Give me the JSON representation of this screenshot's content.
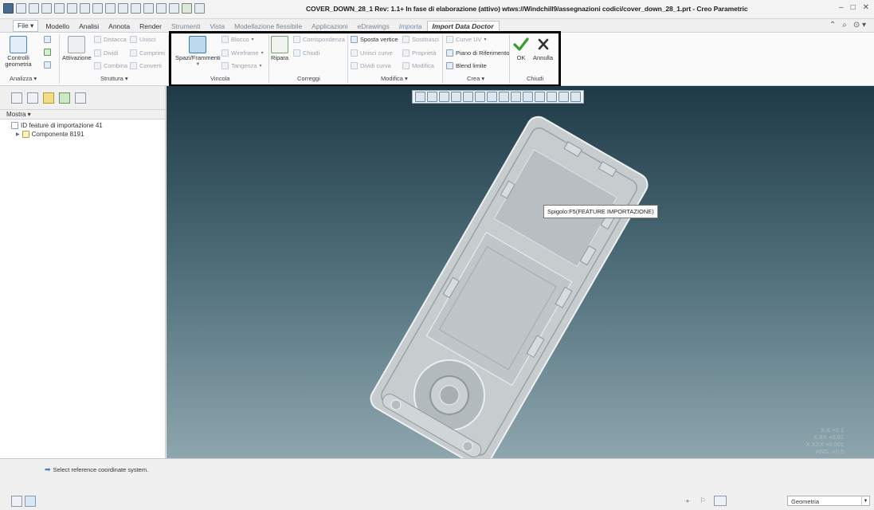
{
  "window": {
    "title": "COVER_DOWN_28_1 Rev: 1.1+ In fase di elaborazione  (attivo) wtws://Windchill9/assegnazioni codici/cover_down_28_1.prt - Creo Parametric",
    "controls": [
      "–",
      "□",
      "✕"
    ]
  },
  "tabs": [
    {
      "label": "File ▾"
    },
    {
      "label": "Modello"
    },
    {
      "label": "Analisi"
    },
    {
      "label": "Annota"
    },
    {
      "label": "Render"
    },
    {
      "label": "Strumenti"
    },
    {
      "label": "Vista"
    },
    {
      "label": "Modellazione flessibile"
    },
    {
      "label": "Applicazioni"
    },
    {
      "label": "eDrawings"
    },
    {
      "label": "Importa"
    },
    {
      "label": "Import Data Doctor"
    }
  ],
  "right_tools": [
    "⌃",
    "⌕",
    "⊙ ▾"
  ],
  "ribbon": {
    "analizza": {
      "group_label": "Analizza ▾",
      "controlli": "Controlli geometria"
    },
    "struttura": {
      "group_label": "Struttura ▾",
      "attivazione": "Attivazione",
      "distacca": "Distacca",
      "unisci": "Unisci",
      "dividi": "Dividi",
      "comprimi": "Comprimi",
      "combina": "Combina",
      "converti": "Converti"
    },
    "vincola": {
      "group_label": "Vincola",
      "spazi": "Spazi/Frammenti",
      "blocco": "Blocco",
      "wireframe": "Wireframe",
      "tangenza": "Tangenza"
    },
    "correggi": {
      "group_label": "Correggi",
      "ripara": "Ripara",
      "corrispondenza": "Corrispondenza",
      "chiudi": "Chiudi"
    },
    "modifica": {
      "group_label": "Modifica ▾",
      "sposta_vertice": "Sposta vertice",
      "sostituisci": "Sostituisci",
      "unisci_curve": "Unisci curve",
      "proprieta": "Proprietà",
      "dividi_curva": "Dividi curva",
      "modifica": "Modifica"
    },
    "crea": {
      "group_label": "Crea ▾",
      "curve_uv": "Curve UV",
      "piano": "Piano di Riferimento",
      "blend": "Blend limite"
    },
    "chiudi": {
      "group_label": "Chiudi",
      "ok": "OK",
      "annulla": "Annulla"
    }
  },
  "model_tree": {
    "mostra": "Mostra ▾",
    "items": [
      {
        "label": "ID feature di importazione 41"
      },
      {
        "label": "Componente 8191"
      }
    ]
  },
  "viewport": {
    "tooltip": "Spigolo:F5(FEATURE IMPORTAZIONE)",
    "tolerances": [
      "X.X +0.1",
      "X.XX +0.01",
      "X.XXX +0.001",
      "ANG. +0.5"
    ]
  },
  "status": {
    "message": "Select reference coordinate system.",
    "filter_value": "Geometria"
  },
  "colors": {
    "ok_green": "#3a9a2e",
    "annulla_dark": "#333333",
    "viewport_top": "#1f3a46",
    "viewport_bottom": "#8ea6ae",
    "highlight_border": "#000000"
  }
}
